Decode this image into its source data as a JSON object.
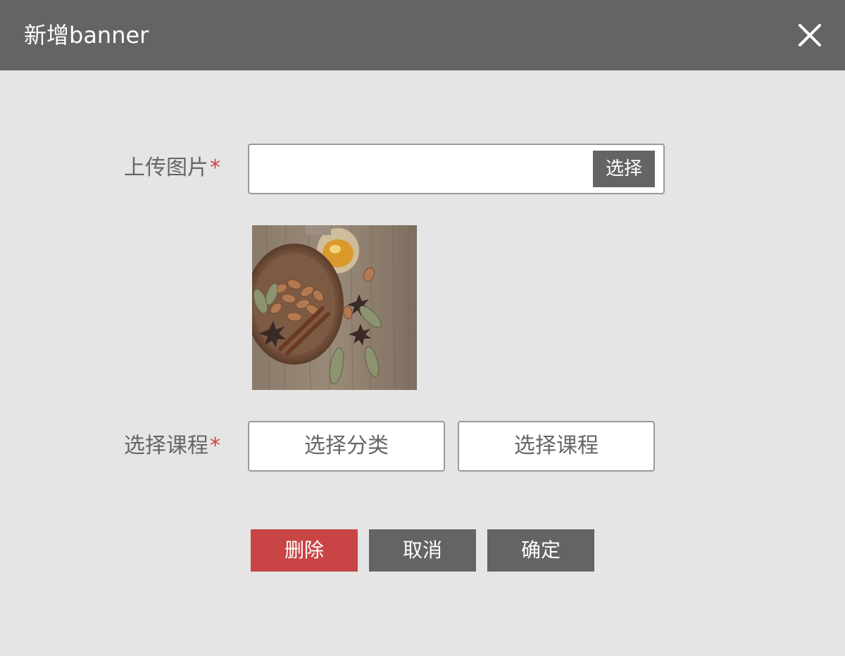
{
  "dialog": {
    "title": "新增banner"
  },
  "form": {
    "upload": {
      "label": "上传图片",
      "required_mark": "*",
      "button_label": "选择",
      "value": ""
    },
    "course": {
      "label": "选择课程",
      "required_mark": "*",
      "category_label": "选择分类",
      "course_label": "选择课程"
    }
  },
  "actions": {
    "delete_label": "删除",
    "cancel_label": "取消",
    "confirm_label": "确定"
  },
  "colors": {
    "header_bg": "#646464",
    "page_bg": "#e5e5e5",
    "delete_bg": "#c94444",
    "neutral_btn_bg": "#646464",
    "required": "#c94444"
  },
  "icons": {
    "close": "close-icon"
  }
}
